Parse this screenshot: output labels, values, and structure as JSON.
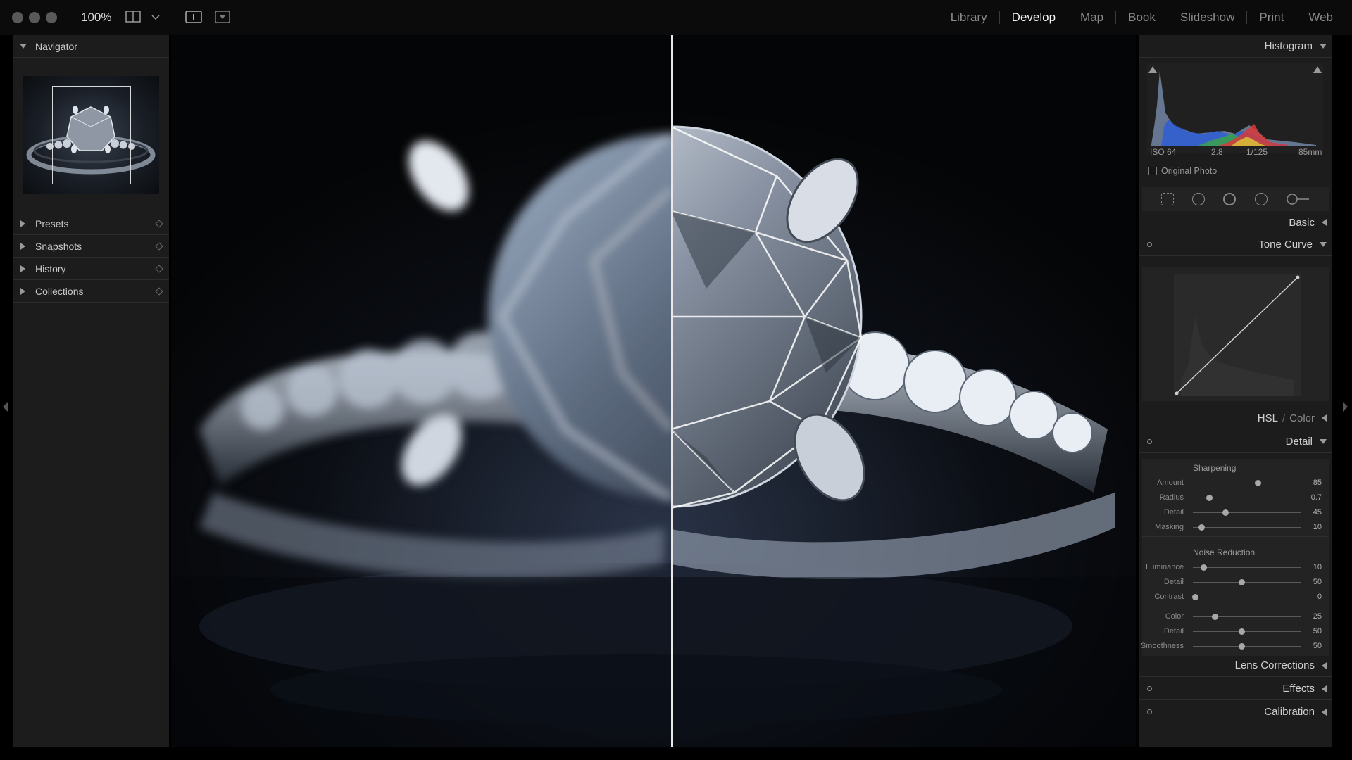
{
  "topbar": {
    "zoom": "100%",
    "modules": [
      "Library",
      "Develop",
      "Map",
      "Book",
      "Slideshow",
      "Print",
      "Web"
    ],
    "active_module": "Develop"
  },
  "left_panel": {
    "navigator": "Navigator",
    "items": [
      "Presets",
      "Snapshots",
      "History",
      "Collections"
    ]
  },
  "right_panel": {
    "histogram_label": "Histogram",
    "exif": {
      "iso": "ISO 64",
      "aperture": "2.8",
      "shutter": "1/125",
      "focal": "85mm"
    },
    "original_photo": "Original Photo",
    "sections": {
      "basic": "Basic",
      "tone_curve": "Tone Curve",
      "hsl": "HSL",
      "color": "Color",
      "detail": "Detail",
      "lens_corrections": "Lens Corrections",
      "effects": "Effects",
      "calibration": "Calibration"
    },
    "detail": {
      "sharpening_title": "Sharpening",
      "sharpening": [
        {
          "label": "Amount",
          "value": "85",
          "pos": 0.6
        },
        {
          "label": "Radius",
          "value": "0.7",
          "pos": 0.15
        },
        {
          "label": "Detail",
          "value": "45",
          "pos": 0.3
        },
        {
          "label": "Masking",
          "value": "10",
          "pos": 0.08
        }
      ],
      "noise_title": "Noise Reduction",
      "noise": [
        {
          "label": "Luminance",
          "value": "10",
          "pos": 0.1
        },
        {
          "label": "Detail",
          "value": "50",
          "pos": 0.45
        },
        {
          "label": "Contrast",
          "value": "0",
          "pos": 0.02
        }
      ],
      "color_noise": [
        {
          "label": "Color",
          "value": "25",
          "pos": 0.2
        },
        {
          "label": "Detail",
          "value": "50",
          "pos": 0.45
        },
        {
          "label": "Smoothness",
          "value": "50",
          "pos": 0.45
        }
      ]
    }
  },
  "colors": {
    "accent": "#f4f4f4",
    "panel_bg": "#1c1c1c",
    "split_line": "#e8e8e8"
  }
}
